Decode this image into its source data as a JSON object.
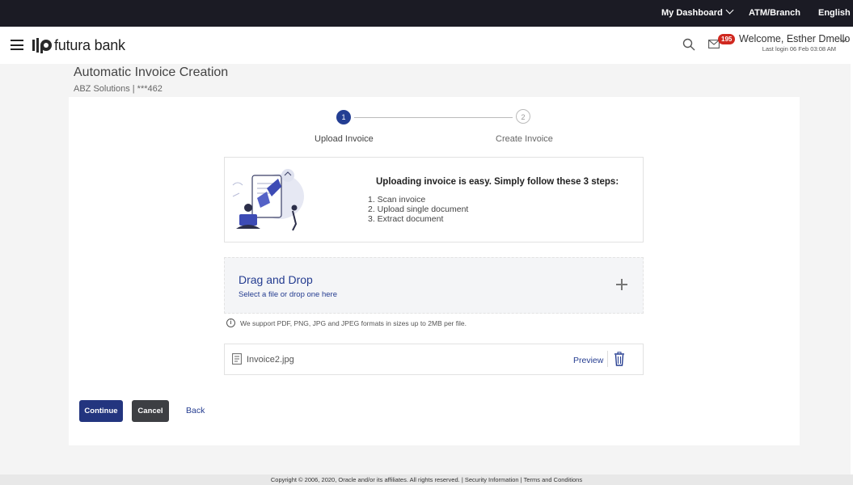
{
  "topbar": {
    "dashboard": "My Dashboard",
    "atm": "ATM/Branch",
    "language": "English"
  },
  "header": {
    "logo_text": "futura bank",
    "mail_count": "195",
    "welcome": "Welcome, Esther Dmello",
    "last_login": "Last login 06 Feb 03:08 AM"
  },
  "page": {
    "title": "Automatic Invoice Creation",
    "subtitle": "ABZ Solutions | ***462"
  },
  "stepper": {
    "steps": [
      {
        "number": "1",
        "label": "Upload Invoice"
      },
      {
        "number": "2",
        "label": "Create Invoice"
      }
    ]
  },
  "info": {
    "title": "Uploading invoice is easy. Simply follow these 3 steps:",
    "steps": [
      "1. Scan invoice",
      "2. Upload single document",
      "3. Extract document"
    ]
  },
  "dropzone": {
    "title": "Drag and Drop",
    "subtitle": "Select a file or drop one here"
  },
  "support_text": "We support PDF, PNG, JPG and JPEG formats in sizes up to 2MB per file.",
  "file": {
    "name": "Invoice2.jpg",
    "preview_label": "Preview"
  },
  "actions": {
    "continue": "Continue",
    "cancel": "Cancel",
    "back": "Back"
  },
  "footer": {
    "copyright": "Copyright © 2006, 2020, Oracle and/or its affiliates. All rights reserved.",
    "security": "Security Information",
    "terms": "Terms and Conditions"
  },
  "colors": {
    "primary": "#23357f",
    "topbar": "#1b1b24",
    "badge": "#d0281f",
    "link": "#243c90"
  }
}
